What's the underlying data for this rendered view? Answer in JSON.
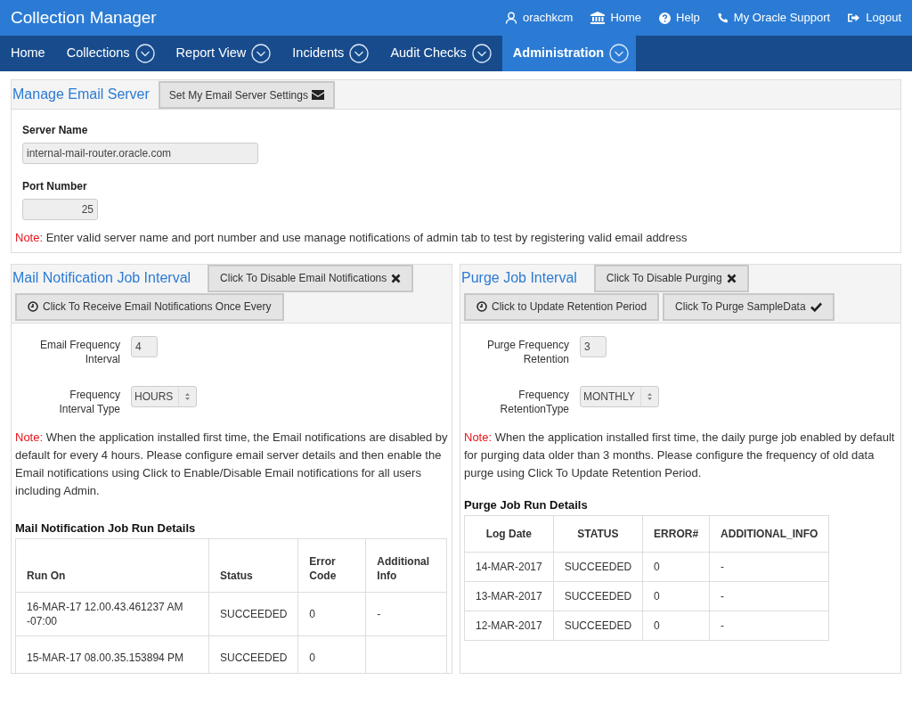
{
  "app_title": "Collection Manager",
  "top_links": [
    {
      "label": "orachkcm"
    },
    {
      "label": "Home"
    },
    {
      "label": "Help"
    },
    {
      "label": "My Oracle Support"
    },
    {
      "label": "Logout"
    }
  ],
  "nav": [
    {
      "label": "Home",
      "dropdown": false,
      "selected": false
    },
    {
      "label": "Collections",
      "dropdown": true,
      "selected": false
    },
    {
      "label": "Report View",
      "dropdown": true,
      "selected": false
    },
    {
      "label": "Incidents",
      "dropdown": true,
      "selected": false
    },
    {
      "label": "Audit Checks",
      "dropdown": true,
      "selected": false
    },
    {
      "label": "Administration",
      "dropdown": true,
      "selected": true
    }
  ],
  "email_server": {
    "title": "Manage Email Server",
    "button": "Set My Email Server Settings",
    "fields": [
      {
        "label": "Server Name",
        "value": "internal-mail-router.oracle.com"
      },
      {
        "label": "Port Number",
        "value": "25"
      }
    ],
    "note_label": "Note:",
    "note": "Enter valid server name and port number and use manage notifications of admin tab to test by registering valid email address"
  },
  "mail_job": {
    "title": "Mail Notification Job Interval",
    "buttons": [
      "Click To Disable Email Notifications",
      "Click To Receive Email Notifications Once Every"
    ],
    "fields": [
      {
        "kind": "input",
        "label": "Email Frequency Interval",
        "value": "4"
      },
      {
        "kind": "select",
        "label": "Frequency Interval Type",
        "value": "HOURS"
      }
    ],
    "note_label": "Note:",
    "note": "When the application installed first time, the Email notifications are disabled by default for every 4 hours. Please configure email server details and then enable the Email notifications using Click to Enable/Disable Email notifications for all users including Admin.",
    "table_title": "Mail Notification Job Run Details",
    "columns": [
      "Run On",
      "Status",
      "Error Code",
      "Additional Info"
    ],
    "rows": [
      [
        "16-MAR-17 12.00.43.461237 AM -07:00",
        "SUCCEEDED",
        "0",
        "-"
      ],
      [
        "15-MAR-17 08.00.35.153894 PM",
        "SUCCEEDED",
        "0"
      ]
    ]
  },
  "purge_job": {
    "title": "Purge Job Interval",
    "buttons": [
      "Click To Disable Purging",
      "Click to Update Retention Period",
      "Click To Purge SampleData"
    ],
    "fields": [
      {
        "kind": "input",
        "label": "Purge Frequency Retention",
        "value": "3"
      },
      {
        "kind": "select",
        "label": "Frequency RetentionType",
        "value": "MONTHLY"
      }
    ],
    "note_label": "Note:",
    "note": "When the application installed first time, the daily purge job enabled by default for purging data older than 3 months. Please configure the frequency of old data purge using Click To Update Retention Period.",
    "table_title": "Purge Job Run Details",
    "columns": [
      "Log Date",
      "STATUS",
      "ERROR#",
      "ADDITIONAL_INFO"
    ],
    "rows": [
      [
        "14-MAR-2017",
        "SUCCEEDED",
        "0",
        "-"
      ],
      [
        "13-MAR-2017",
        "SUCCEEDED",
        "0",
        "-"
      ],
      [
        "12-MAR-2017",
        "SUCCEEDED",
        "0",
        "-"
      ]
    ]
  }
}
